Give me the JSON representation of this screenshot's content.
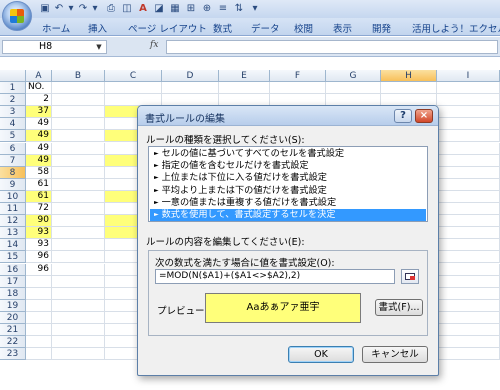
{
  "ribbon": {
    "tabs": [
      "ホーム",
      "挿入",
      "ページ レイアウト",
      "数式",
      "データ",
      "校閲",
      "表示",
      "開発",
      "活用しよう！エクセル"
    ]
  },
  "formula_bar": {
    "name_box": "H8",
    "fx": "fx",
    "formula": ""
  },
  "sheet": {
    "columns": [
      "A",
      "B",
      "C",
      "D",
      "E",
      "F",
      "G",
      "H",
      "I"
    ],
    "selected_column": "H",
    "selected_row": "8",
    "rows": [
      {
        "n": "1",
        "a": "NO."
      },
      {
        "n": "2",
        "a": "2"
      },
      {
        "n": "3",
        "a": "37"
      },
      {
        "n": "4",
        "a": "49"
      },
      {
        "n": "5",
        "a": "49"
      },
      {
        "n": "6",
        "a": "49"
      },
      {
        "n": "7",
        "a": "49"
      },
      {
        "n": "8",
        "a": "58"
      },
      {
        "n": "9",
        "a": "61"
      },
      {
        "n": "10",
        "a": "61"
      },
      {
        "n": "11",
        "a": "72"
      },
      {
        "n": "12",
        "a": "90"
      },
      {
        "n": "13",
        "a": "93"
      },
      {
        "n": "14",
        "a": "93"
      },
      {
        "n": "15",
        "a": "96"
      },
      {
        "n": "16",
        "a": "96"
      },
      {
        "n": "17",
        "a": ""
      },
      {
        "n": "18",
        "a": ""
      },
      {
        "n": "19",
        "a": ""
      },
      {
        "n": "20",
        "a": ""
      },
      {
        "n": "21",
        "a": ""
      },
      {
        "n": "22",
        "a": ""
      },
      {
        "n": "23",
        "a": ""
      }
    ]
  },
  "dialog": {
    "title": "書式ルールの編集",
    "help": "?",
    "close": "×",
    "rule_type_label": "ルールの種類を選択してください(S):",
    "rule_types": [
      "セルの値に基づいてすべてのセルを書式設定",
      "指定の値を含むセルだけを書式設定",
      "上位または下位に入る値だけを書式設定",
      "平均より上または下の値だけを書式設定",
      "一意の値または重複する値だけを書式設定",
      "数式を使用して、書式設定するセルを決定"
    ],
    "selected_rule_index": 5,
    "edit_label": "ルールの内容を編集してください(E):",
    "condition_label": "次の数式を満たす場合に値を書式設定(O):",
    "formula": "=MOD(N($A1)+($A1<>$A2),2)",
    "preview_label": "プレビュー:",
    "preview_text": "Aaあぁアァ亜宇",
    "format_button": "書式(F)...",
    "ok_button": "OK",
    "cancel_button": "キャンセル",
    "preview_bg": "#ffff7a",
    "selection_color": "#3399ff"
  }
}
